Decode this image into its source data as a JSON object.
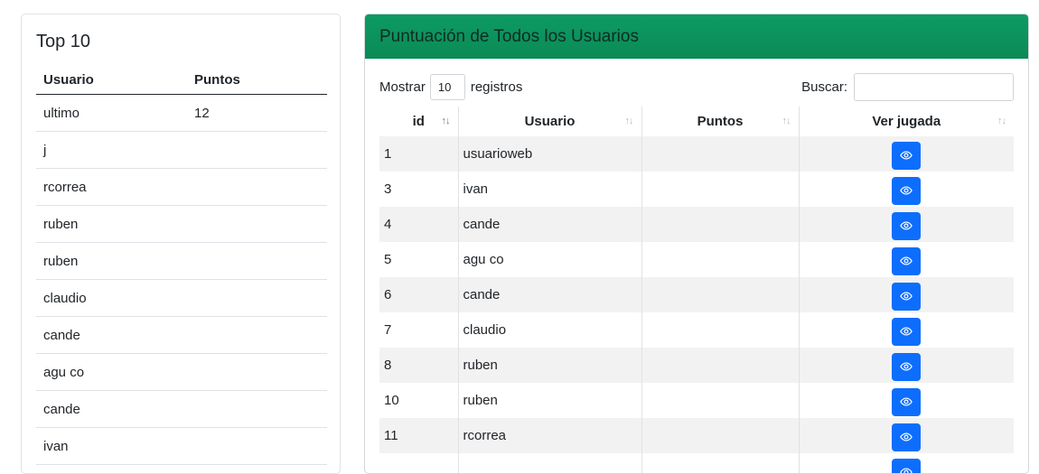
{
  "top10": {
    "title": "Top 10",
    "headers": {
      "user": "Usuario",
      "points": "Puntos"
    },
    "rows": [
      {
        "user": "ultimo",
        "points": "12"
      },
      {
        "user": "j",
        "points": ""
      },
      {
        "user": "rcorrea",
        "points": ""
      },
      {
        "user": "ruben",
        "points": ""
      },
      {
        "user": "ruben",
        "points": ""
      },
      {
        "user": "claudio",
        "points": ""
      },
      {
        "user": "cande",
        "points": ""
      },
      {
        "user": "agu co",
        "points": ""
      },
      {
        "user": "cande",
        "points": ""
      },
      {
        "user": "ivan",
        "points": ""
      }
    ]
  },
  "scores": {
    "title": "Puntuación de Todos los Usuarios",
    "show_label": "Mostrar",
    "page_length": "10",
    "records_label": "registros",
    "search_label": "Buscar:",
    "search_value": "",
    "columns": {
      "id": "id",
      "user": "Usuario",
      "points": "Puntos",
      "view": "Ver jugada"
    },
    "sort_icon": "↑↓",
    "rows": [
      {
        "id": "1",
        "user": "usuarioweb",
        "points": ""
      },
      {
        "id": "3",
        "user": "ivan",
        "points": ""
      },
      {
        "id": "4",
        "user": "cande",
        "points": ""
      },
      {
        "id": "5",
        "user": "agu co",
        "points": ""
      },
      {
        "id": "6",
        "user": "cande",
        "points": ""
      },
      {
        "id": "7",
        "user": "claudio",
        "points": ""
      },
      {
        "id": "8",
        "user": "ruben",
        "points": ""
      },
      {
        "id": "10",
        "user": "ruben",
        "points": ""
      },
      {
        "id": "11",
        "user": "rcorrea",
        "points": ""
      },
      {
        "id": "",
        "user": "",
        "points": ""
      }
    ]
  },
  "icons": {
    "view": "eye-icon"
  },
  "colors": {
    "header_green": "#0e9b63",
    "button_blue": "#0d6efd",
    "stripe": "#f2f2f2"
  }
}
